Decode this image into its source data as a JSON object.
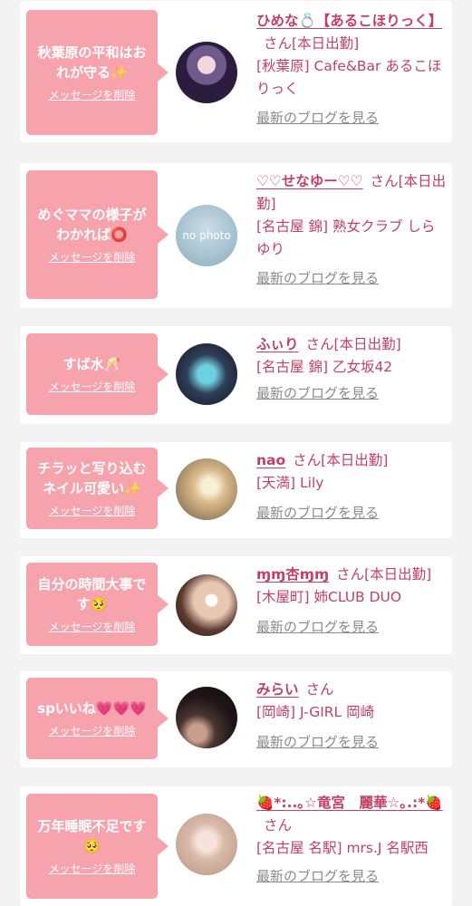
{
  "delete_label": "メッセージを削除",
  "blog_label": "最新のブログを見る",
  "honorific": "さん",
  "colors": {
    "accent": "#c43f63",
    "bubble": "#f6a3ad",
    "background": "#f3f3f3",
    "link_gray": "#8a8a8a"
  },
  "entries": [
    {
      "message": "秋葉原の平和はおれが守る✨",
      "name": "ひめな💍【あるこほりっく】",
      "status": "[本日出勤]",
      "shop": "[秋葉原] Cafe&Bar あるこほりっく",
      "avatar": "avatar-photo"
    },
    {
      "message": "めぐママの様子がわかれば⭕",
      "name": "♡♡せなゆー♡♡",
      "status": "[本日出勤]",
      "shop": "[名古屋 錦] 熟女クラブ しらゆり",
      "avatar": "no-photo",
      "avatar_text": "no photo"
    },
    {
      "message": "すば水🥂",
      "name": "ふぃり",
      "status": "[本日出勤]",
      "shop": "[名古屋 錦] 乙女坂42",
      "avatar": "avatar-photo"
    },
    {
      "message": "チラッと写り込むネイル可愛い✨",
      "name": "nao",
      "status": "[本日出勤]",
      "shop": "[天満] Lily",
      "avatar": "avatar-photo"
    },
    {
      "message": "自分の時間大事です🥺",
      "name": "ɱɱ杏ɱɱ",
      "status": "[本日出勤]",
      "shop": "[木屋町] 姉CLUB DUO",
      "avatar": "avatar-photo"
    },
    {
      "message": "spいいね💗💗💗",
      "name": "みらい",
      "status": "",
      "shop": "[岡崎] J-GIRL 岡崎",
      "avatar": "avatar-photo"
    },
    {
      "message": "万年睡眠不足です🥺",
      "name": "🍓*:..｡☆竜宮　麗華☆｡.:*🍓",
      "status": "",
      "shop": "[名古屋 名駅] mrs.J 名駅西",
      "avatar": "avatar-photo"
    }
  ]
}
